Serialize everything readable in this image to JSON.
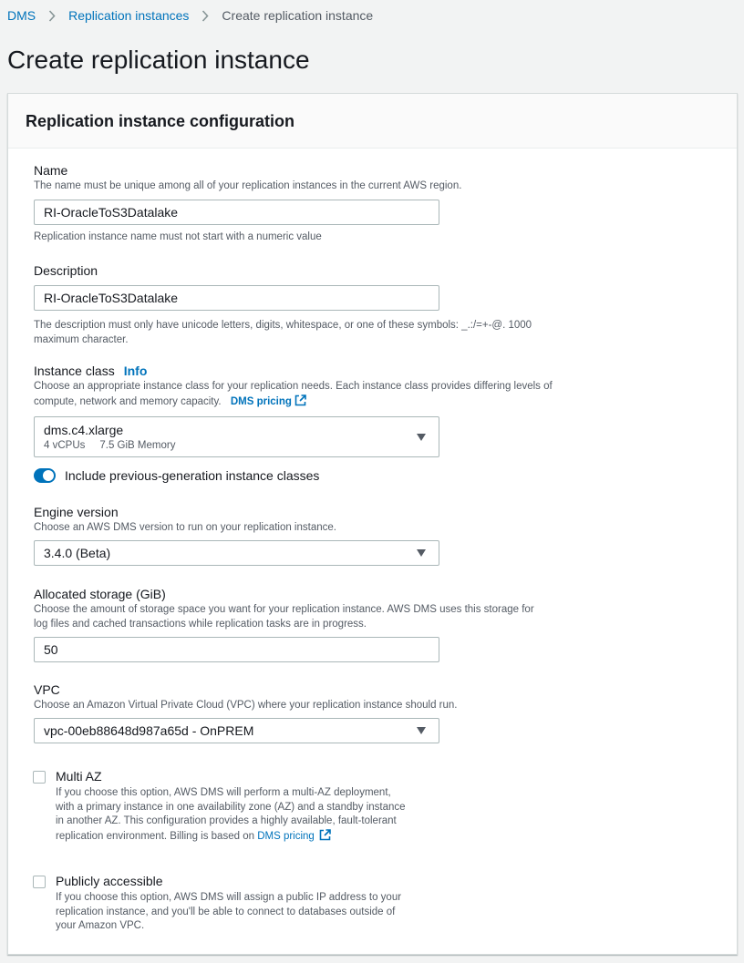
{
  "breadcrumb": {
    "root": "DMS",
    "parent": "Replication instances",
    "current": "Create replication instance"
  },
  "page": {
    "title": "Create replication instance"
  },
  "panel": {
    "title": "Replication instance configuration"
  },
  "name_field": {
    "label": "Name",
    "description": "The name must be unique among all of your replication instances in the current AWS region.",
    "value": "RI-OracleToS3Datalake",
    "hint": "Replication instance name must not start with a numeric value"
  },
  "description_field": {
    "label": "Description",
    "value": "RI-OracleToS3Datalake",
    "hint_line1": "The description must only have unicode letters, digits, whitespace, or one of these symbols: _.:/=+-@. 1000",
    "hint_line2": "maximum character."
  },
  "instance_class": {
    "label": "Instance class",
    "info_link": "Info",
    "description_line1": "Choose an appropriate instance class for your replication needs. Each instance class provides differing levels of",
    "description_line2": "compute, network and memory capacity.",
    "pricing_link": "DMS pricing",
    "selected": "dms.c4.xlarge",
    "vcpus": "4 vCPUs",
    "memory": "7.5 GiB Memory"
  },
  "toggle": {
    "label": "Include previous-generation instance classes",
    "enabled": true
  },
  "engine_version": {
    "label": "Engine version",
    "description": "Choose an AWS DMS version to run on your replication instance.",
    "selected": "3.4.0 (Beta)"
  },
  "allocated_storage": {
    "label": "Allocated storage (GiB)",
    "description_line1": "Choose the amount of storage space you want for your replication instance. AWS DMS uses this storage for",
    "description_line2": "log files and cached transactions while replication tasks are in progress.",
    "value": "50"
  },
  "vpc": {
    "label": "VPC",
    "description": "Choose an Amazon Virtual Private Cloud (VPC) where your replication instance should run.",
    "selected": "vpc-00eb88648d987a65d - OnPREM"
  },
  "multi_az": {
    "label": "Multi AZ",
    "checked": false,
    "desc_line1": "If you choose this option, AWS DMS will perform a multi-AZ deployment,",
    "desc_line2": "with a primary instance in one availability zone (AZ) and a standby instance",
    "desc_line3": "in another AZ. This configuration provides a highly available, fault-tolerant",
    "desc_line4": "replication environment. Billing is based on",
    "pricing_link": "DMS pricing"
  },
  "publicly_accessible": {
    "label": "Publicly accessible",
    "checked": false,
    "desc_line1": "If you choose this option, AWS DMS will assign a public IP address to your",
    "desc_line2": "replication instance, and you'll be able to connect to databases outside of",
    "desc_line3": "your Amazon VPC."
  },
  "colors": {
    "link": "#0073bb",
    "text": "#16191f",
    "muted": "#545b64",
    "border": "#aab7b8",
    "background": "#f2f3f3"
  }
}
